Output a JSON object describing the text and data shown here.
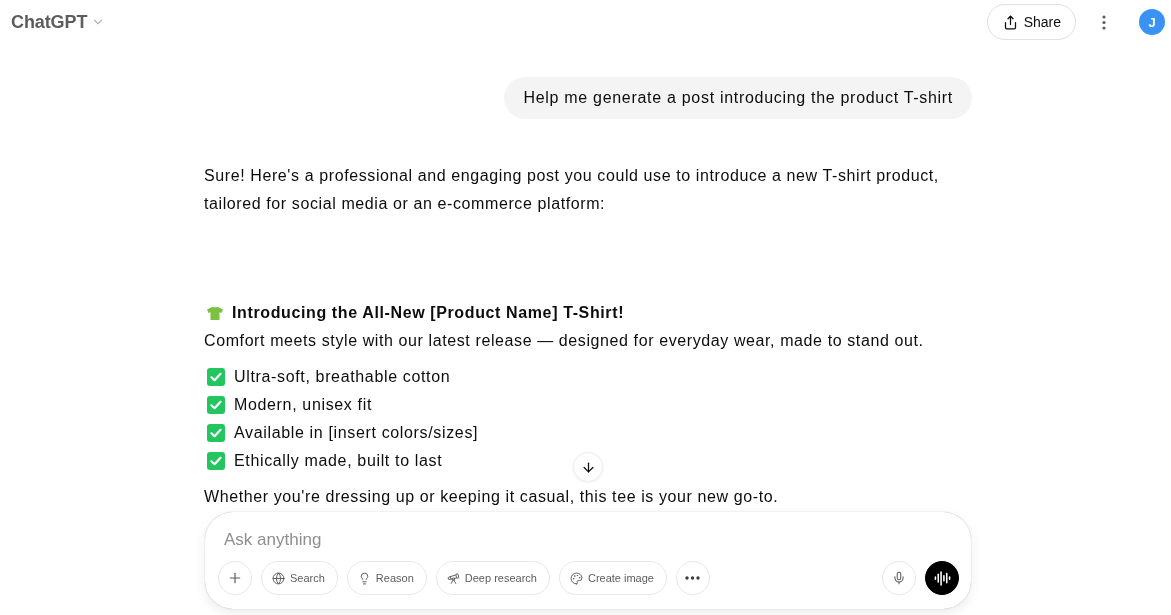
{
  "header": {
    "title": "ChatGPT",
    "share": "Share",
    "avatar": "J"
  },
  "user_message": {
    "text": "Help me generate a post introducing the product T-shirt"
  },
  "reply": {
    "blocks": [
      {
        "kind": "paragraph",
        "text": "Sure! Here's a professional and engaging post you could use to introduce a new T-shirt product, tailored for social media or an e-commerce platform:"
      },
      {
        "kind": "heading",
        "text": "Introducing the All-New [Product Name] T-Shirt!"
      },
      {
        "kind": "paragraph",
        "text": "Comfort meets style with our latest release — designed for everyday wear, made to stand out."
      },
      {
        "kind": "checklist",
        "items": [
          {
            "text": "Ultra-soft, breathable cotton",
            "checked": true
          },
          {
            "text": "Modern, unisex fit",
            "checked": true
          },
          {
            "text": "Available in [insert colors/sizes]",
            "checked": true
          },
          {
            "text": "Ethically made, built to last",
            "checked": true
          }
        ]
      },
      {
        "kind": "paragraph",
        "text": "Whether you're dressing up or keeping it casual, this tee is your new go-to."
      }
    ]
  },
  "composer": {
    "placeholder": "Ask anything",
    "tools": [
      {
        "kind": "search",
        "label": "Search"
      },
      {
        "kind": "reason",
        "label": "Reason"
      },
      {
        "kind": "deep_research",
        "label": "Deep research"
      },
      {
        "kind": "create_image",
        "label": "Create image"
      }
    ]
  }
}
